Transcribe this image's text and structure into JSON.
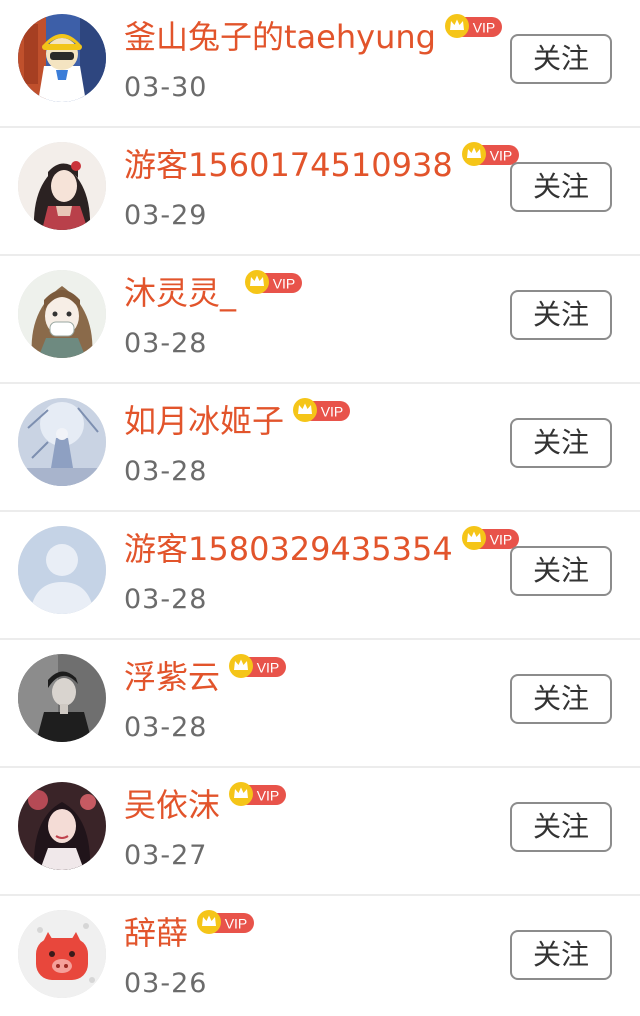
{
  "follow_label": "关注",
  "vip_text": "VIP",
  "colors": {
    "name": "#e2542b",
    "vip_badge": "#e8534a",
    "crown": "#f5c518",
    "date": "#6b6b6b",
    "divider": "#ececec"
  },
  "users": [
    {
      "name": "釜山兔子的taehyung",
      "date": "03-30",
      "avatar": "cartoon-avatar-icon"
    },
    {
      "name": "游客1560174510938",
      "date": "03-29",
      "avatar": "anime-girl-avatar-icon"
    },
    {
      "name": "沐灵灵_",
      "date": "03-28",
      "avatar": "masked-girl-avatar-icon"
    },
    {
      "name": "如月冰姬子",
      "date": "03-28",
      "avatar": "ice-scene-avatar-icon"
    },
    {
      "name": "游客1580329435354",
      "date": "03-28",
      "avatar": "default-user-avatar-icon"
    },
    {
      "name": "浮紫云",
      "date": "03-28",
      "avatar": "photo-man-avatar-icon"
    },
    {
      "name": "吴依沫",
      "date": "03-27",
      "avatar": "photo-woman-avatar-icon"
    },
    {
      "name": "辞薛",
      "date": "03-26",
      "avatar": "pig-avatar-icon"
    }
  ]
}
